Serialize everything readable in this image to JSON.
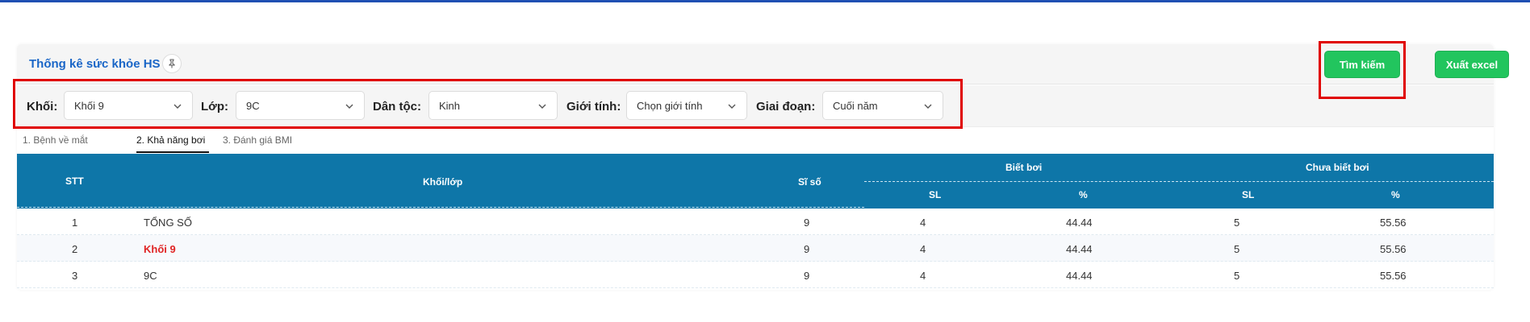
{
  "header": {
    "title": "Thống kê sức khỏe HS",
    "search_label": "Tìm kiếm",
    "excel_label": "Xuất excel",
    "accent_green": "#22c55e",
    "title_color": "#1a66c7"
  },
  "filters": {
    "khoi_label": "Khối:",
    "khoi_value": "Khối 9",
    "lop_label": "Lớp:",
    "lop_value": "9C",
    "dantoc_label": "Dân tộc:",
    "dantoc_value": "Kinh",
    "gioitinh_label": "Giới tính:",
    "gioitinh_value": "Chọn giới tính",
    "giaidoan_label": "Giai đoạn:",
    "giaidoan_value": "Cuối năm"
  },
  "tabs": [
    {
      "label": "1. Bệnh về mắt"
    },
    {
      "label": "2. Khả năng bơi"
    },
    {
      "label": "3. Đánh giá BMI"
    }
  ],
  "table": {
    "header_color": "#0e76a8",
    "headers": {
      "stt": "STT",
      "khoilop": "Khối/lớp",
      "siso": "Sĩ số",
      "bietboi": "Biết bơi",
      "chuabietboi": "Chưa biết bơi",
      "sl1": "SL",
      "pct1": "%",
      "sl2": "SL",
      "pct2": "%"
    },
    "rows": [
      {
        "stt": "1",
        "name": "TỔNG SỐ",
        "siso": "9",
        "sl1": "4",
        "pct1": "44.44",
        "sl2": "5",
        "pct2": "55.56"
      },
      {
        "stt": "2",
        "name": "Khối 9",
        "siso": "9",
        "sl1": "4",
        "pct1": "44.44",
        "sl2": "5",
        "pct2": "55.56"
      },
      {
        "stt": "3",
        "name": "9C",
        "siso": "9",
        "sl1": "4",
        "pct1": "44.44",
        "sl2": "5",
        "pct2": "55.56"
      }
    ]
  },
  "icons": {
    "pin": "pin-icon",
    "chevron": "chevron-down-icon"
  }
}
